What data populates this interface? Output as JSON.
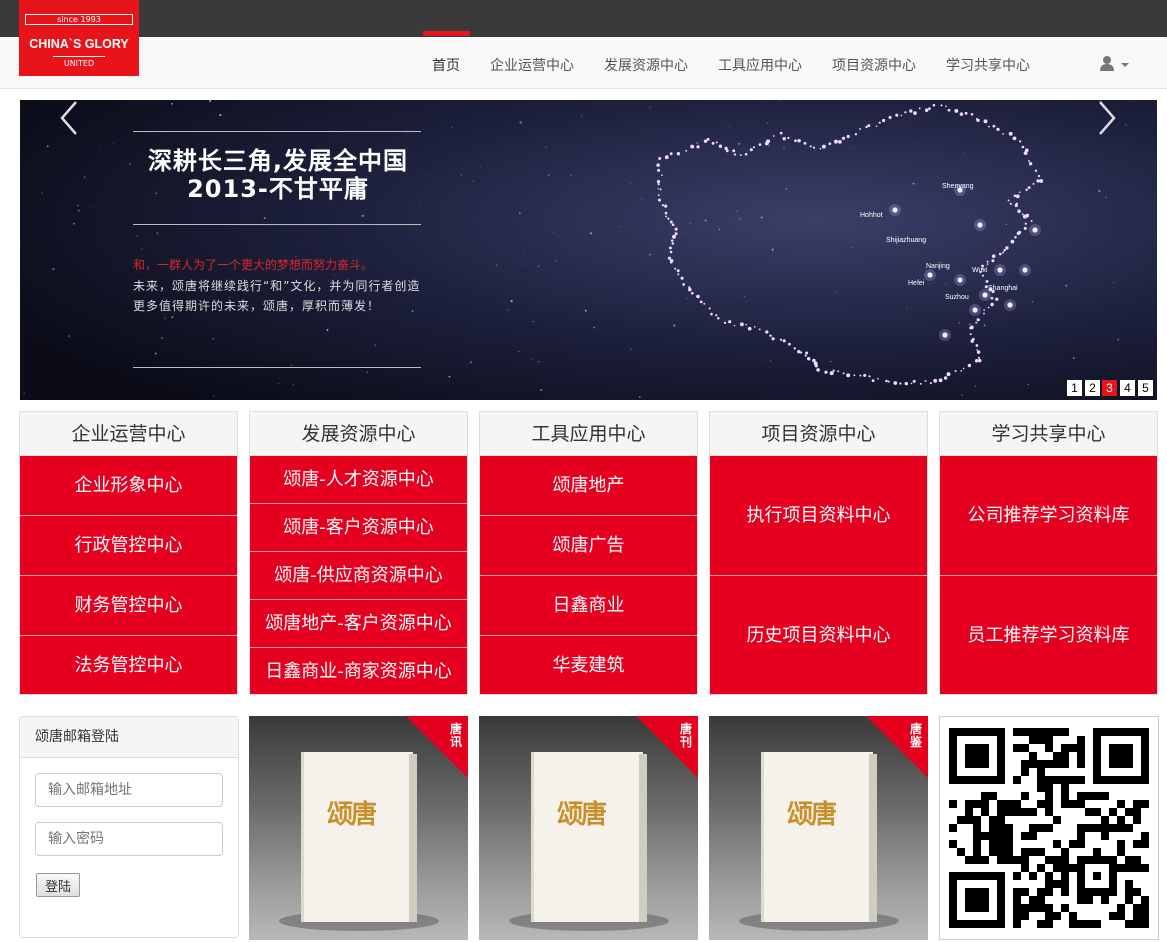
{
  "logo": {
    "since": "since 1993",
    "brand": "CHINA`S GLORY",
    "united": "UNITED"
  },
  "nav": {
    "items": [
      {
        "label": "首页",
        "active": true
      },
      {
        "label": "企业运营中心"
      },
      {
        "label": "发展资源中心"
      },
      {
        "label": "工具应用中心"
      },
      {
        "label": "项目资源中心"
      },
      {
        "label": "学习共享中心"
      }
    ],
    "user_icon": "user-icon",
    "caret_icon": "caret-down-icon"
  },
  "carousel": {
    "heading_line1": "深耕长三角,发展全中国",
    "heading_line2": "2013-不甘平庸",
    "red_text": "和，一群人为了一个更大的梦想而努力奋斗。",
    "paragraph": "未来，颂唐将继续践行“和”文化，并为同行者创造更多值得期许的未来，颂唐，厚积而薄发！",
    "cities": [
      "Shenyang",
      "Hohhot",
      "Shijiazhuang",
      "Nanjing",
      "Wuxi",
      "Hefei",
      "Shanghai",
      "Suzhou"
    ],
    "indicators": [
      "1",
      "2",
      "3",
      "4",
      "5"
    ],
    "active_indicator": 3,
    "accent": "#e7141a"
  },
  "panels": [
    {
      "title": "企业运营中心",
      "items": [
        "企业形象中心",
        "行政管控中心",
        "财务管控中心",
        "法务管控中心"
      ]
    },
    {
      "title": "发展资源中心",
      "items": [
        "颂唐-人才资源中心",
        "颂唐-客户资源中心",
        "颂唐-供应商资源中心",
        "颂唐地产-客户资源中心",
        "日鑫商业-商家资源中心"
      ]
    },
    {
      "title": "工具应用中心",
      "items": [
        "颂唐地产",
        "颂唐广告",
        "日鑫商业",
        "华麦建筑"
      ]
    },
    {
      "title": "项目资源中心",
      "items": [
        "执行项目资料中心",
        "历史项目资料中心"
      ]
    },
    {
      "title": "学习共享中心",
      "items": [
        "公司推荐学习资料库",
        "员工推荐学习资料库"
      ]
    }
  ],
  "login": {
    "title": "颂唐邮箱登陆",
    "email_placeholder": "输入邮箱地址",
    "password_placeholder": "输入密码",
    "submit": "登陆"
  },
  "magazines": [
    {
      "tag": "唐讯",
      "cover_logo": "颂唐"
    },
    {
      "tag": "唐刊",
      "cover_logo": "颂唐"
    },
    {
      "tag": "唐鉴",
      "cover_logo": "颂唐"
    }
  ],
  "colors": {
    "brand_red": "#e60020",
    "topbar": "#3a3a3a"
  }
}
